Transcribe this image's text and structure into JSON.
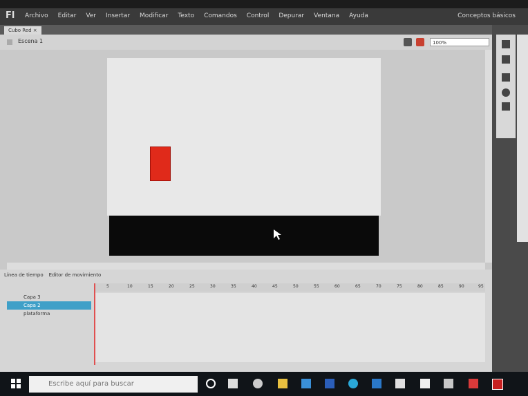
{
  "menubar": {
    "logo": "Fl",
    "items": [
      "Archivo",
      "Editar",
      "Ver",
      "Insertar",
      "Modificar",
      "Texto",
      "Comandos",
      "Control",
      "Depurar",
      "Ventana",
      "Ayuda"
    ],
    "workspace": "Conceptos básicos"
  },
  "doc_tab": "Cubo Red",
  "editbar": {
    "scene": "Escena 1",
    "zoom": "100%"
  },
  "timeline": {
    "tabs": [
      "Línea de tiempo",
      "Editor de movimiento"
    ],
    "layers": [
      "Capa 3",
      "Capa 2",
      "plataforma"
    ],
    "frame_numbers": [
      "5",
      "10",
      "15",
      "20",
      "25",
      "30",
      "35",
      "40",
      "45",
      "50",
      "55",
      "60",
      "65",
      "70",
      "75",
      "80",
      "85",
      "90",
      "95"
    ]
  },
  "taskbar": {
    "search_placeholder": "Escribe aquí para buscar"
  },
  "colors": {
    "stage": "#e8e8e8",
    "ground": "#0a0a0a",
    "player": "#e02a1a",
    "selection": "#3fa0c8"
  }
}
